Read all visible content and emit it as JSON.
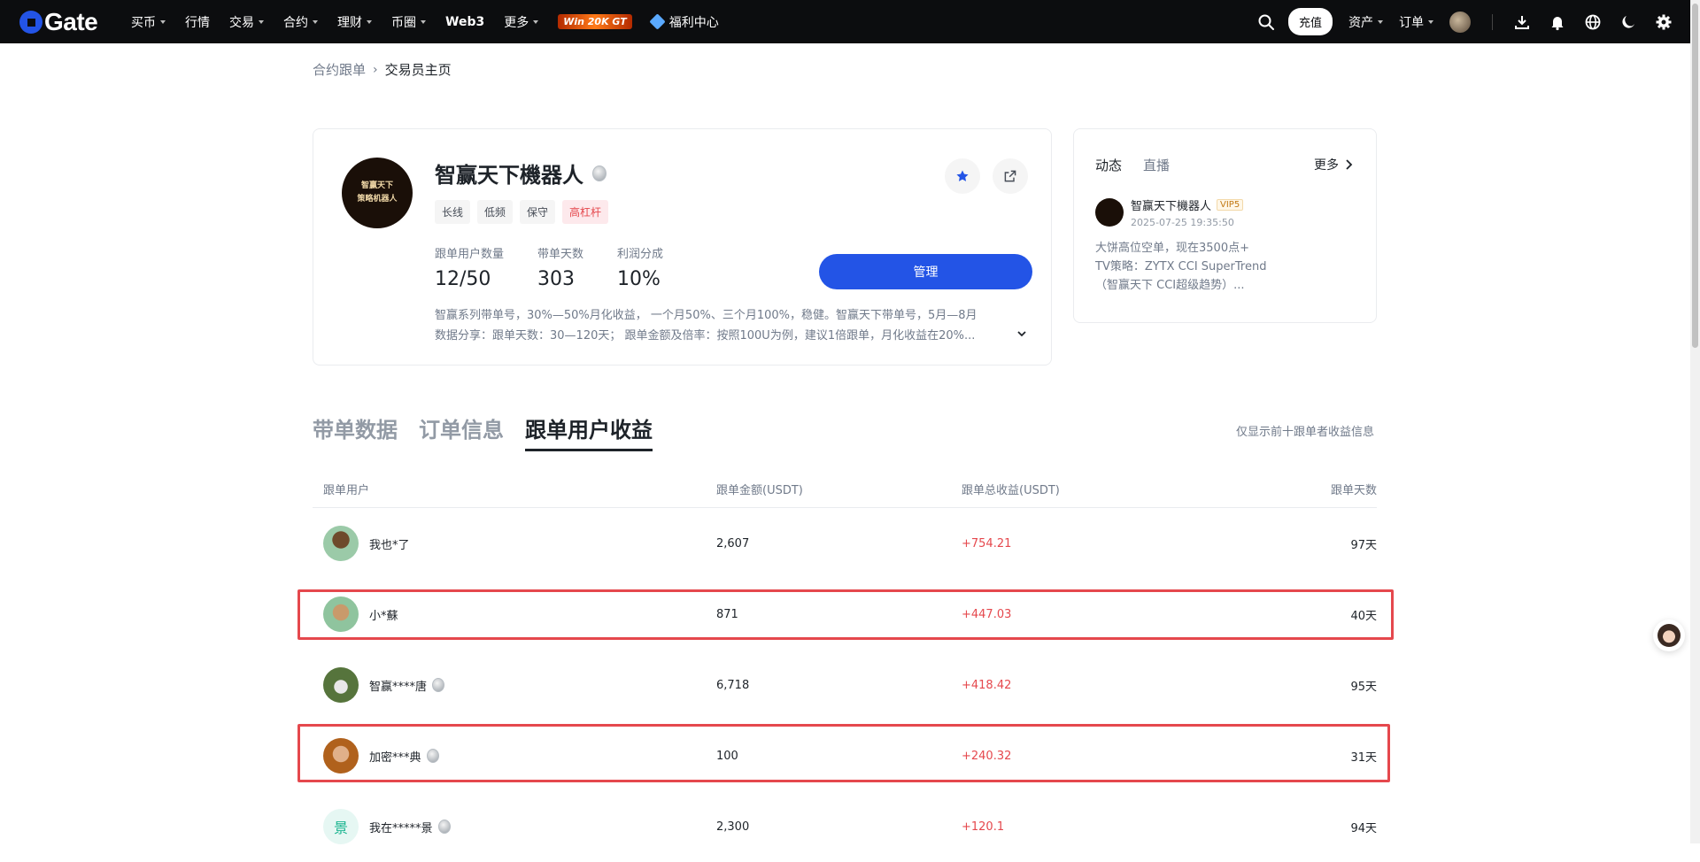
{
  "nav": {
    "logo_text": "Gate",
    "items": [
      {
        "label": "买币",
        "caret": true
      },
      {
        "label": "行情",
        "caret": false
      },
      {
        "label": "交易",
        "caret": true
      },
      {
        "label": "合约",
        "caret": true
      },
      {
        "label": "理财",
        "caret": true
      },
      {
        "label": "币圈",
        "caret": true
      },
      {
        "label": "Web3",
        "caret": false
      },
      {
        "label": "更多",
        "caret": true
      }
    ],
    "promo": "Win 20K GT",
    "welfare": "福利中心",
    "deposit": "充值",
    "assets": "资产",
    "orders": "订单"
  },
  "breadcrumb": {
    "parent": "合约跟单",
    "current": "交易员主页"
  },
  "profile": {
    "avatar_text": [
      "智赢天下",
      "策略机器人"
    ],
    "name": "智赢天下機器人",
    "tags": [
      "长线",
      "低频",
      "保守",
      "高杠杆"
    ],
    "stats": [
      {
        "label": "跟单用户数量",
        "value": "12/50"
      },
      {
        "label": "带单天数",
        "value": "303"
      },
      {
        "label": "利润分成",
        "value": "10%"
      }
    ],
    "manage_label": "管理",
    "desc_line1": "智赢系列带单号，30%—50%月化收益，  一个月50%、三个月100%，稳健。智赢天下带单号，5月—8月",
    "desc_line2": "数据分享：跟单天数：30—120天；  跟单金额及倍率：按照100U为例，建议1倍跟单，月化收益在20%..."
  },
  "feed": {
    "tab_active": "动态",
    "tab_other": "直播",
    "more": "更多",
    "author": "智赢天下機器人",
    "vip": "VIP5",
    "time": "2025-07-25 19:35:50",
    "body_line1": "大饼高位空单，现在3500点+",
    "body_line2": "TV策略：ZYTX CCI SuperTrend",
    "body_line3": "（智赢天下 CCI超级趋势）..."
  },
  "section": {
    "tabs": [
      "带单数据",
      "订单信息",
      "跟单用户收益"
    ],
    "active_index": 2,
    "note": "仅显示前十跟单者收益信息"
  },
  "table": {
    "headers": [
      "跟单用户",
      "跟单金额(USDT)",
      "跟单总收益(USDT)",
      "跟单天数"
    ],
    "rows": [
      {
        "user": "我也*了",
        "amount": "2,607",
        "pnl": "+754.21",
        "days": "97天",
        "medal": false,
        "avatar_char": ""
      },
      {
        "user": "小*蘇",
        "amount": "871",
        "pnl": "+447.03",
        "days": "40天",
        "medal": false,
        "avatar_char": ""
      },
      {
        "user": "智赢****唐",
        "amount": "6,718",
        "pnl": "+418.42",
        "days": "95天",
        "medal": true,
        "avatar_char": ""
      },
      {
        "user": "加密***典",
        "amount": "100",
        "pnl": "+240.32",
        "days": "31天",
        "medal": true,
        "avatar_char": ""
      },
      {
        "user": "我在*****景",
        "amount": "2,300",
        "pnl": "+120.1",
        "days": "94天",
        "medal": true,
        "avatar_char": "景"
      }
    ]
  },
  "colors": {
    "accent": "#2354e6",
    "profit": "#e5484d",
    "nav_bg": "#0c0d0f",
    "highlight_box": "#e5484d"
  }
}
